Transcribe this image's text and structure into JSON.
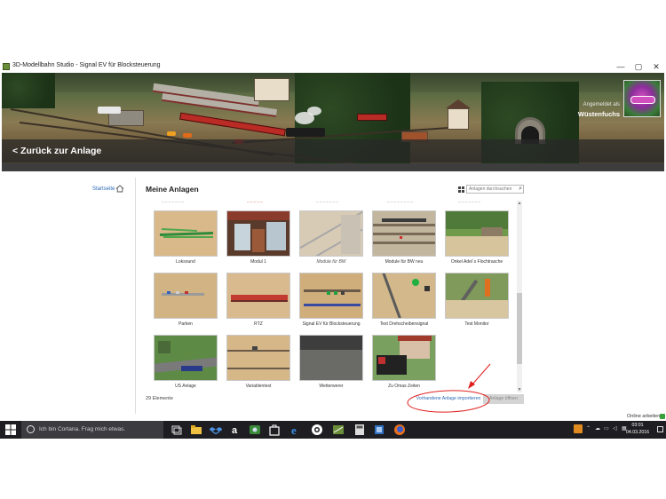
{
  "window": {
    "title": "3D-Modellbahn Studio - Signal EV für Blocksteuerung",
    "minimize": "—",
    "maximize": "▢",
    "close": "✕"
  },
  "hero": {
    "back_link": "< Zurück zur Anlage",
    "logged_in_as": "Angemeldet als",
    "username": "Wüstenfuchs"
  },
  "nav": {
    "start_label": "Startseite"
  },
  "main": {
    "title": "Meine Anlagen",
    "search_placeholder": "Anlagen durchsuchen",
    "cut_labels": [
      "– – – – – – –",
      "– – – – –",
      "– – – – – – –",
      "– – – – – – – –",
      "– – – – – – –"
    ],
    "items": [
      {
        "label": "Loksound"
      },
      {
        "label": "Modul 1"
      },
      {
        "label": "Module für BW"
      },
      {
        "label": "Module für BW neu"
      },
      {
        "label": "Onkel Adel´s Flochtrasche"
      },
      {
        "label": "Parken"
      },
      {
        "label": "RTZ"
      },
      {
        "label": "Signal EV für Blocksteuerung"
      },
      {
        "label": "Test Drehscheibensignal"
      },
      {
        "label": "Test Monitor"
      },
      {
        "label": "US Anlage"
      },
      {
        "label": "Variablentest"
      },
      {
        "label": "Wetterwerer"
      },
      {
        "label": "Zu Omas Zeiten"
      }
    ],
    "count": "29 Elemente",
    "import_label": "Vorhandene Anlage importieren",
    "open_label": "Anlage öffnen"
  },
  "taskbar": {
    "cortana": "Ich bin Cortana. Frag mich etwas.",
    "time": "03:01",
    "date": "04.03.2016",
    "apps": [
      "task-view",
      "file-explorer",
      "store",
      "dropbox",
      "amazon",
      "app-green",
      "office",
      "edge",
      "steam",
      "modellbahn",
      "calculator",
      "app-blue",
      "firefox"
    ]
  },
  "status": {
    "online": "Online arbeiten"
  },
  "colors": {
    "accent": "#2b6ab5",
    "annotation": "#e02020",
    "taskbar": "#1e1e22"
  }
}
